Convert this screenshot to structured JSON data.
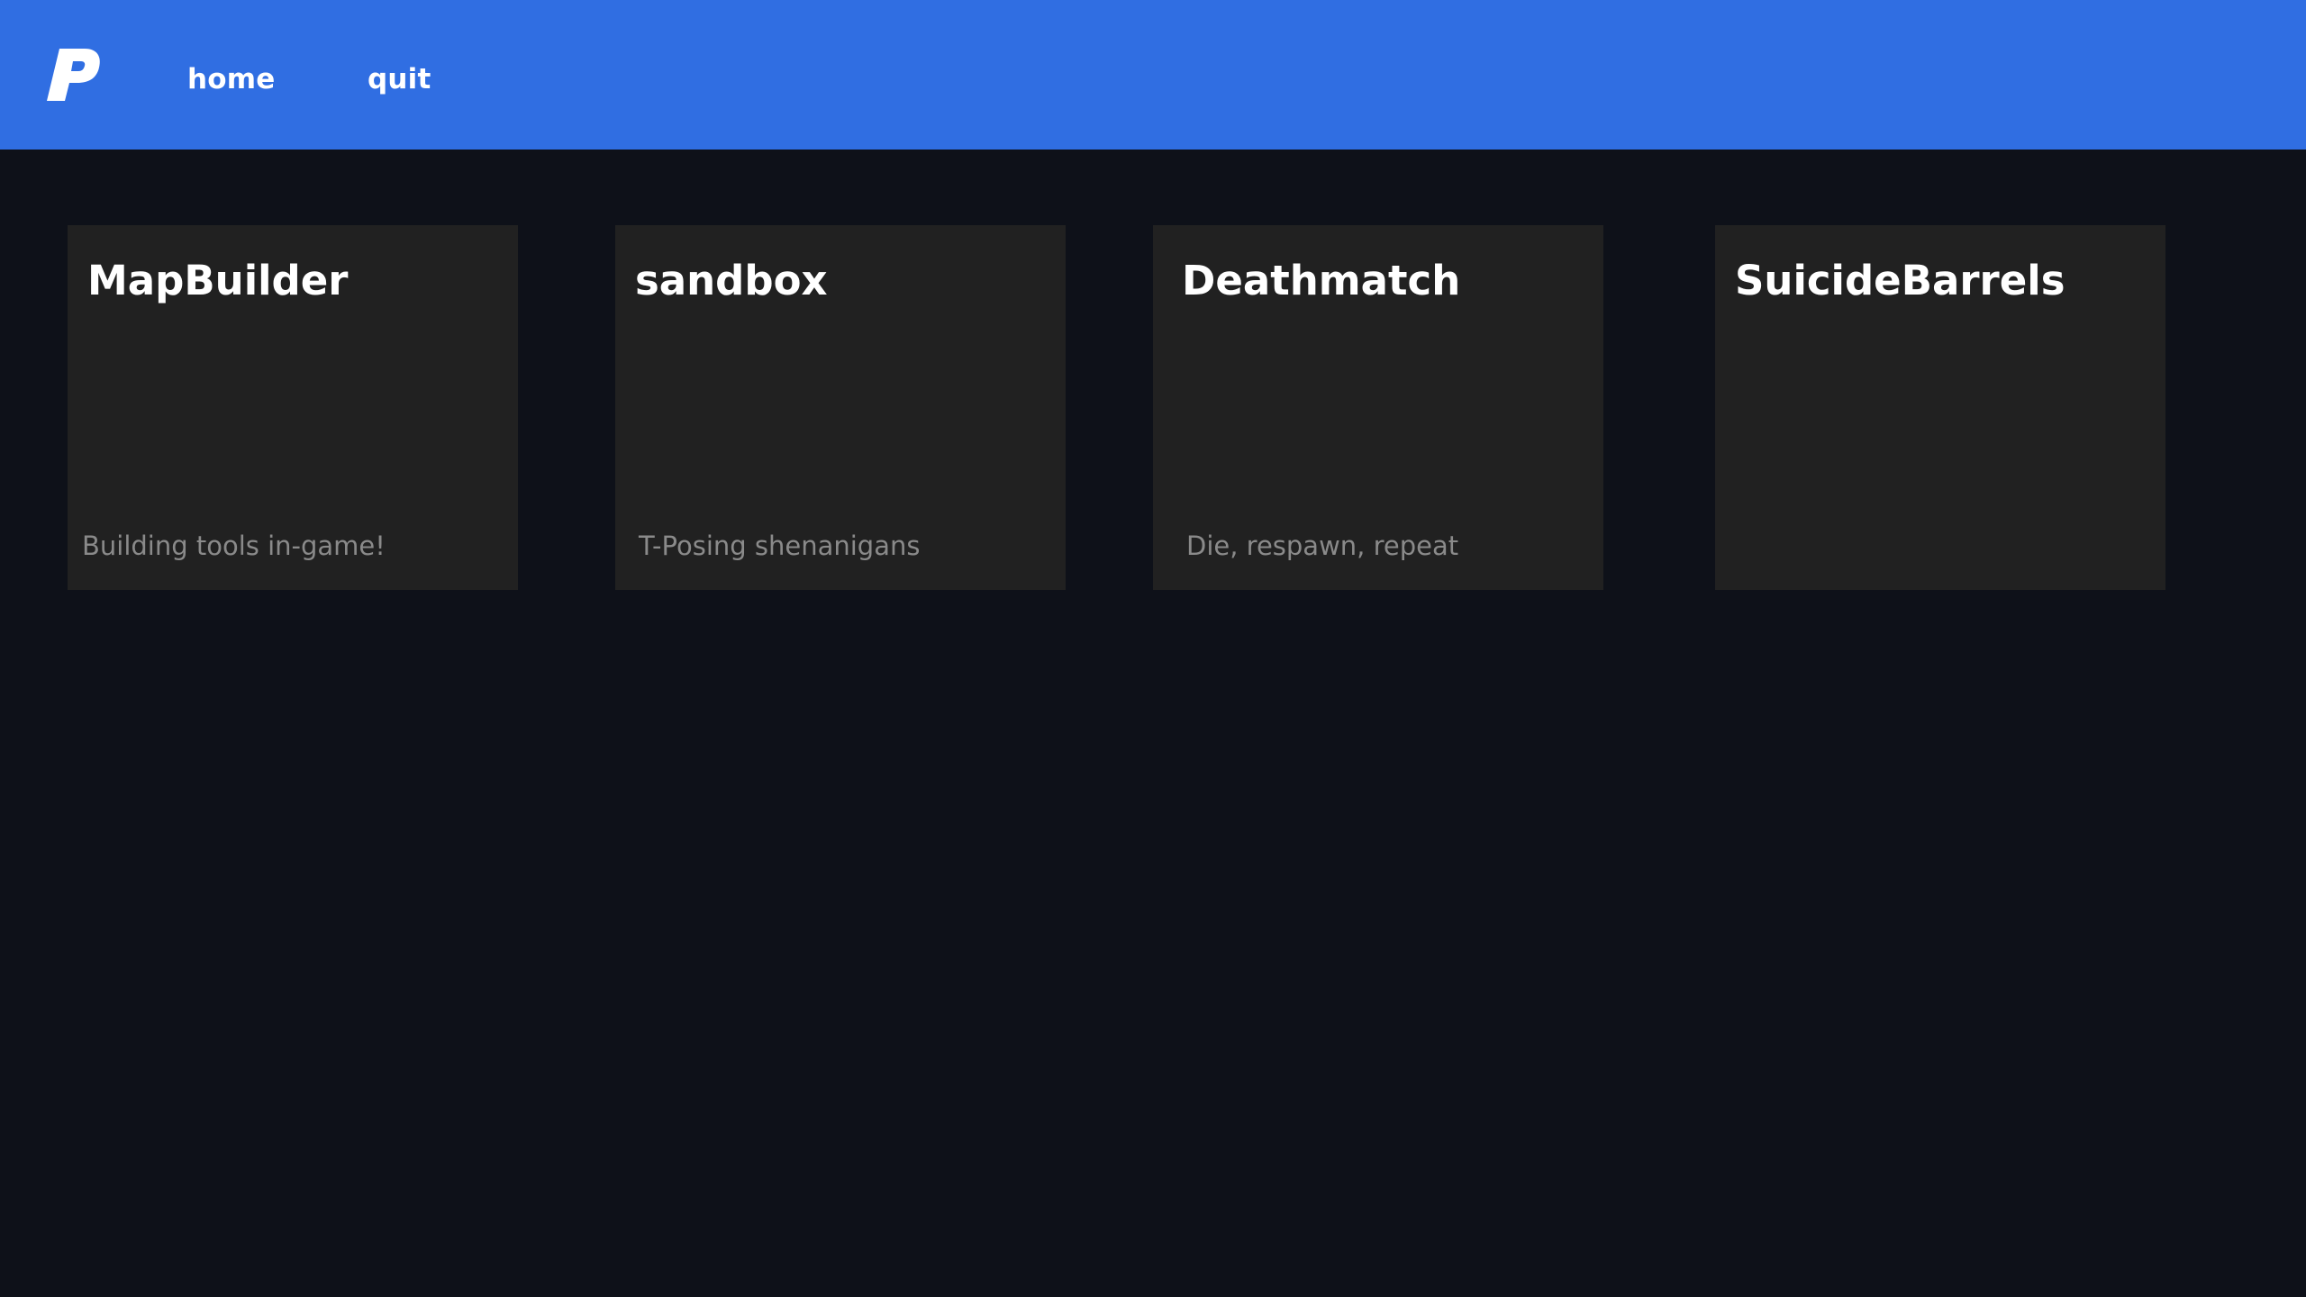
{
  "header": {
    "logo_icon": "p-logo-icon",
    "nav": {
      "home_label": "home",
      "quit_label": "quit"
    },
    "background_color": "#306ee2"
  },
  "gamemodes": [
    {
      "title": "MapBuilder",
      "description": "Building tools in-game!"
    },
    {
      "title": "sandbox",
      "description": "T-Posing shenanigans"
    },
    {
      "title": "Deathmatch",
      "description": "Die, respawn, repeat"
    },
    {
      "title": "SuicideBarrels",
      "description": ""
    }
  ],
  "colors": {
    "page_background": "#0e1119",
    "card_background": "#212121",
    "title_text": "#ffffff",
    "description_text": "#8a8a8a"
  }
}
